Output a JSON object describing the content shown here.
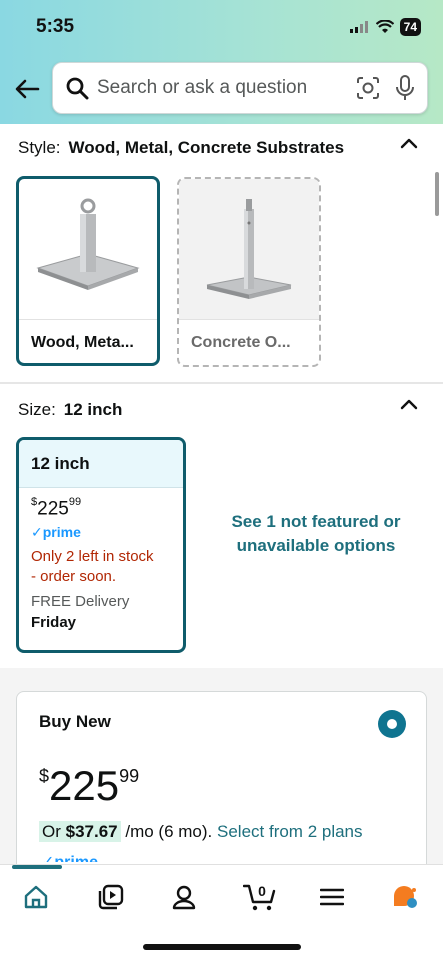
{
  "status": {
    "time": "5:35",
    "battery": "74"
  },
  "search": {
    "placeholder": "Search or ask a question"
  },
  "style_section": {
    "label": "Style:",
    "value": "Wood, Metal, Concrete Substrates",
    "options": [
      {
        "name": "Wood, Meta...",
        "selected": true
      },
      {
        "name": "Concrete O...",
        "selected": false
      }
    ]
  },
  "size_section": {
    "label": "Size:",
    "value": "12 inch",
    "option": {
      "name": "12 inch",
      "price_dollar": "$",
      "price_whole": "225",
      "price_cents": "99",
      "prime": "✓prime",
      "stock_line1": "Only 2 left in stock",
      "stock_line2": "- order soon.",
      "delivery": "FREE Delivery",
      "delivery_day": "Friday"
    },
    "see_more": "See 1 not featured or unavailable options"
  },
  "buy_new": {
    "title": "Buy New",
    "price_symbol": "$",
    "price_whole": "225",
    "price_cents": "99",
    "monthly_prefix": "Or",
    "monthly_amount": "$37.67",
    "monthly_term": "/mo (6 mo).",
    "plans_link": "Select from 2 plans",
    "prime": "✓prime"
  },
  "nav": [
    "home-icon",
    "video-icon",
    "account-icon",
    "cart-icon",
    "menu-icon",
    "rufus-icon"
  ],
  "cart_count": "0",
  "colors": {
    "accent": "#0f5c6b",
    "link": "#1e6f7d",
    "stock": "#b12704",
    "prime": "#1a98ff"
  }
}
